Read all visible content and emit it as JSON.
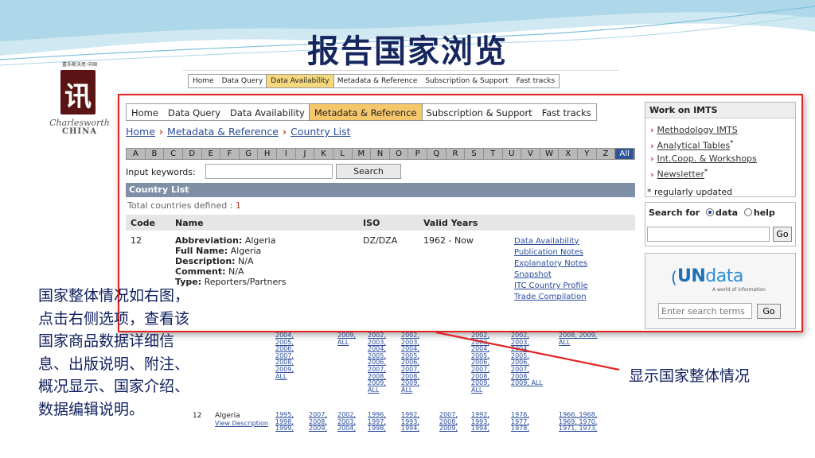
{
  "slide": {
    "title": "报告国家浏览",
    "left_note": "国家整体情况如右图，点击右侧选项，查看该国家商品数据详细信息、出版说明、附注、概况显示、国家介绍、数据编辑说明。",
    "right_note": "显示国家整体情况"
  },
  "logo": {
    "caption": "喜乐斯沃思·中国",
    "mark": "讯",
    "brand": "Charlesworth",
    "country": "CHINA"
  },
  "bg_nav": [
    "Home",
    "Data Query",
    "Data Availability",
    "Metadata & Reference",
    "Subscription & Support",
    "Fast tracks"
  ],
  "bg_table": {
    "columns": [
      "2004,\n2005,\n2006,\n2007,\n2008,\n2009,\nALL",
      "2009,\nALL",
      "2002,\n2003,\n2004,\n2005,\n2006,\n2007,\n2008,\n2009,\nALL",
      "2002,\n2003,\n2004,\n2005,\n2006,\n2007,\n2008,\n2009,\nALL",
      "2002,\n2003,\n2004,\n2005,\n2006,\n2007,\n2008,\n2009,\nALL",
      "2002,\n2003,\n2004,\n2005,\n2006,\n2007,\n2008,\n2009, ALL",
      "2008, 2009,\nALL"
    ],
    "row": {
      "code": "12",
      "name": "Algeria",
      "desc": "View Description",
      "cols": [
        "1995,\n1998,\n1999,",
        "2007,\n2008,\n2009,",
        "2002,\n2003,\n2004,",
        "1996,\n1997,\n1998,",
        "1992,\n1993,\n1994,",
        "2007,\n2008,\n2009,",
        "1992,\n1993,\n1994,",
        "1976,\n1977,\n1978,",
        "1966, 1968,\n1969, 1970,\n1971, 1973,"
      ]
    }
  },
  "nav": [
    "Home",
    "Data Query",
    "Data Availability",
    "Metadata & Reference",
    "Subscription & Support",
    "Fast tracks"
  ],
  "breadcrumb": [
    "Home",
    "Metadata & Reference",
    "Country List"
  ],
  "alphabet": [
    "A",
    "B",
    "C",
    "D",
    "E",
    "F",
    "G",
    "H",
    "I",
    "J",
    "K",
    "L",
    "M",
    "N",
    "O",
    "P",
    "Q",
    "R",
    "S",
    "T",
    "U",
    "V",
    "W",
    "X",
    "Y",
    "Z",
    "All"
  ],
  "search": {
    "label": "Input keywords:",
    "button": "Search"
  },
  "country_list": {
    "title": "Country List",
    "total_label": "Total countries defined : ",
    "total_value": "1",
    "headers": {
      "code": "Code",
      "name": "Name",
      "iso": "ISO",
      "years": "Valid Years"
    },
    "row": {
      "code": "12",
      "abbr_key": "Abbreviation:",
      "abbr_val": "Algeria",
      "full_key": "Full Name:",
      "full_val": "Algeria",
      "desc_key": "Description:",
      "desc_val": "N/A",
      "comment_key": "Comment:",
      "comment_val": "N/A",
      "type_key": "Type:",
      "type_val": "Reporters/Partners",
      "iso": "DZ/DZA",
      "years": "1962 - Now",
      "links": [
        "Data Availability",
        "Publication Notes",
        "Explanatory Notes",
        "Snapshot",
        "ITC Country Profile",
        "Trade Compilation"
      ]
    }
  },
  "sidebar": {
    "title": "Work on IMTS",
    "links": [
      "Methodology IMTS",
      "Analytical Tables",
      "Int.Coop. & Workshops",
      "Newsletter"
    ],
    "note": "* regularly updated",
    "search_for": "Search for",
    "opt_data": "data",
    "opt_help": "help",
    "go": "Go"
  },
  "undata": {
    "un": "UN",
    "data": "data",
    "tagline": "A world of information",
    "placeholder": "Enter search terms",
    "go": "Go"
  }
}
